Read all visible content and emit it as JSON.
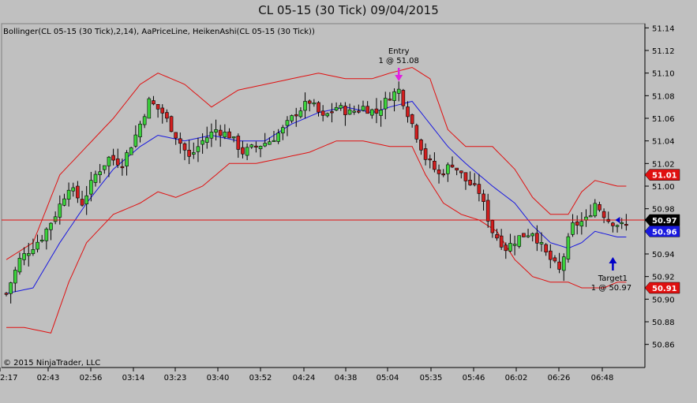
{
  "window": {
    "title": "CL 05-15 (30 Tick)  09/04/2015"
  },
  "indicators_label": "Bollinger(CL 05-15 (30 Tick),2,14), AaPriceLine, HeikenAshi(CL 05-15 (30 Tick))",
  "copyright": "© 2015 NinjaTrader, LLC",
  "colors": {
    "background": "#c0c0c0",
    "up": "#3cd23c",
    "down": "#d21e1e",
    "band": "#e01010",
    "middle": "#1818e0",
    "price_line": "#e01010",
    "entry_arrow": "#e020e0",
    "target_arrow": "#0000c8"
  },
  "chart_data": {
    "type": "candlestick",
    "instrument": "CL 05-15 (30 Tick)",
    "ylim": [
      50.85,
      51.15
    ],
    "y_ticks": [
      "51.14",
      "51.12",
      "51.10",
      "51.08",
      "51.06",
      "51.04",
      "51.02",
      "51.00",
      "50.98",
      "50.96",
      "50.94",
      "50.92",
      "50.90",
      "50.88",
      "50.86"
    ],
    "x_ticks": [
      "2:17",
      "02:43",
      "02:56",
      "03:14",
      "03:23",
      "03:40",
      "03:52",
      "04:24",
      "04:38",
      "05:04",
      "05:35",
      "05:46",
      "06:02",
      "06:26",
      "06:48"
    ],
    "candle_keyframes": [
      [
        0,
        50.905
      ],
      [
        3,
        50.935
      ],
      [
        8,
        50.955
      ],
      [
        11,
        50.975
      ],
      [
        14,
        51.0
      ],
      [
        17,
        50.985
      ],
      [
        20,
        51.01
      ],
      [
        23,
        51.025
      ],
      [
        26,
        51.02
      ],
      [
        29,
        51.045
      ],
      [
        32,
        51.075
      ],
      [
        35,
        51.065
      ],
      [
        38,
        51.045
      ],
      [
        41,
        51.025
      ],
      [
        44,
        51.04
      ],
      [
        47,
        51.05
      ],
      [
        50,
        51.045
      ],
      [
        53,
        51.03
      ],
      [
        56,
        51.035
      ],
      [
        59,
        51.04
      ],
      [
        62,
        51.05
      ],
      [
        65,
        51.065
      ],
      [
        68,
        51.075
      ],
      [
        71,
        51.06
      ],
      [
        74,
        51.07
      ],
      [
        77,
        51.065
      ],
      [
        80,
        51.07
      ],
      [
        83,
        51.065
      ],
      [
        86,
        51.08
      ],
      [
        88,
        51.085
      ],
      [
        91,
        51.055
      ],
      [
        94,
        51.025
      ],
      [
        97,
        51.01
      ],
      [
        100,
        51.02
      ],
      [
        103,
        51.005
      ],
      [
        106,
        50.995
      ],
      [
        109,
        50.96
      ],
      [
        112,
        50.945
      ],
      [
        115,
        50.955
      ],
      [
        118,
        50.96
      ],
      [
        121,
        50.94
      ],
      [
        124,
        50.925
      ],
      [
        127,
        50.965
      ],
      [
        130,
        50.97
      ],
      [
        132,
        50.985
      ],
      [
        135,
        50.97
      ],
      [
        138,
        50.965
      ]
    ],
    "upper_band_keyframes": [
      [
        0,
        50.935
      ],
      [
        6,
        50.95
      ],
      [
        12,
        51.01
      ],
      [
        18,
        51.035
      ],
      [
        24,
        51.06
      ],
      [
        30,
        51.09
      ],
      [
        34,
        51.1
      ],
      [
        40,
        51.09
      ],
      [
        46,
        51.07
      ],
      [
        52,
        51.085
      ],
      [
        58,
        51.09
      ],
      [
        64,
        51.095
      ],
      [
        70,
        51.1
      ],
      [
        76,
        51.095
      ],
      [
        82,
        51.095
      ],
      [
        86,
        51.1
      ],
      [
        91,
        51.105
      ],
      [
        95,
        51.095
      ],
      [
        99,
        51.05
      ],
      [
        103,
        51.035
      ],
      [
        109,
        51.035
      ],
      [
        114,
        51.015
      ],
      [
        118,
        50.99
      ],
      [
        122,
        50.975
      ],
      [
        126,
        50.975
      ],
      [
        129,
        50.995
      ],
      [
        132,
        51.005
      ],
      [
        137,
        51.0
      ]
    ],
    "lower_band_keyframes": [
      [
        0,
        50.875
      ],
      [
        4,
        50.875
      ],
      [
        10,
        50.87
      ],
      [
        14,
        50.915
      ],
      [
        18,
        50.95
      ],
      [
        24,
        50.975
      ],
      [
        30,
        50.985
      ],
      [
        34,
        50.995
      ],
      [
        38,
        50.99
      ],
      [
        44,
        51.0
      ],
      [
        50,
        51.02
      ],
      [
        56,
        51.02
      ],
      [
        62,
        51.025
      ],
      [
        68,
        51.03
      ],
      [
        74,
        51.04
      ],
      [
        80,
        51.04
      ],
      [
        86,
        51.035
      ],
      [
        91,
        51.035
      ],
      [
        94,
        51.01
      ],
      [
        98,
        50.985
      ],
      [
        102,
        50.975
      ],
      [
        106,
        50.97
      ],
      [
        110,
        50.96
      ],
      [
        114,
        50.935
      ],
      [
        118,
        50.92
      ],
      [
        122,
        50.915
      ],
      [
        126,
        50.915
      ],
      [
        129,
        50.91
      ],
      [
        134,
        50.91
      ],
      [
        137,
        50.915
      ]
    ],
    "middle_band_keyframes": [
      [
        0,
        50.905
      ],
      [
        6,
        50.91
      ],
      [
        12,
        50.95
      ],
      [
        18,
        50.985
      ],
      [
        24,
        51.015
      ],
      [
        30,
        51.035
      ],
      [
        34,
        51.045
      ],
      [
        40,
        51.04
      ],
      [
        46,
        51.045
      ],
      [
        52,
        51.04
      ],
      [
        58,
        51.04
      ],
      [
        64,
        51.055
      ],
      [
        70,
        51.065
      ],
      [
        76,
        51.07
      ],
      [
        82,
        51.065
      ],
      [
        86,
        51.07
      ],
      [
        91,
        51.075
      ],
      [
        95,
        51.055
      ],
      [
        99,
        51.035
      ],
      [
        103,
        51.02
      ],
      [
        109,
        51.0
      ],
      [
        114,
        50.985
      ],
      [
        118,
        50.965
      ],
      [
        122,
        50.95
      ],
      [
        126,
        50.945
      ],
      [
        129,
        50.95
      ],
      [
        132,
        50.96
      ],
      [
        137,
        50.955
      ]
    ],
    "price_line": 50.97,
    "price_badges": [
      {
        "value": "51.01",
        "bg": "#e01010",
        "fg": "#ffffff"
      },
      {
        "value": "50.97",
        "bg": "#000000",
        "fg": "#ffffff"
      },
      {
        "value": "50.96",
        "bg": "#1818e0",
        "fg": "#ffffff"
      },
      {
        "value": "50.91",
        "bg": "#e01010",
        "fg": "#ffffff"
      }
    ],
    "annotations": {
      "entry": {
        "label": "Entry",
        "detail": "1 @ 51.08",
        "bar_index": 88
      },
      "target": {
        "label": "Target1",
        "detail": "1 @ 50.97",
        "bar_index": 136
      }
    }
  }
}
